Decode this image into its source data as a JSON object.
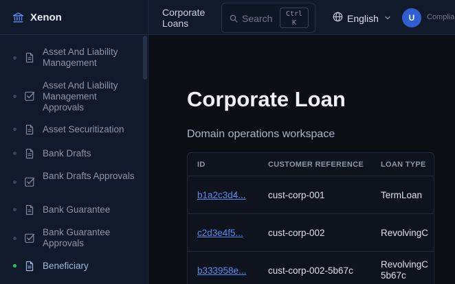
{
  "brand": {
    "name": "Xenon"
  },
  "sidebar": {
    "items": [
      {
        "label": "Asset And Liability Management",
        "icon": "document-icon"
      },
      {
        "label": "Asset And Liability Management Approvals",
        "icon": "checkbox-icon"
      },
      {
        "label": "Asset Securitization",
        "icon": "document-icon"
      },
      {
        "label": "Bank Drafts",
        "icon": "document-icon"
      },
      {
        "label": "Bank Drafts Approvals",
        "icon": "checkbox-icon"
      },
      {
        "label": "Bank Guarantee",
        "icon": "document-icon"
      },
      {
        "label": "Bank Guarantee Approvals",
        "icon": "checkbox-icon"
      },
      {
        "label": "Beneficiary",
        "icon": "document-icon",
        "active": true
      }
    ]
  },
  "header": {
    "breadcrumb": "Corporate Loans",
    "search": {
      "placeholder": "Search",
      "shortcut_top": "Ctrl",
      "shortcut_bottom": "K"
    },
    "language": "English",
    "avatar_initial": "U",
    "user_name": "Complia"
  },
  "main": {
    "title": "Corporate Loan",
    "subtitle": "Domain operations workspace",
    "table": {
      "columns": [
        "ID",
        "CUSTOMER REFERENCE",
        "LOAN TYPE"
      ],
      "rows": [
        {
          "id": "b1a2c3d4...",
          "customer_reference": "cust-corp-001",
          "loan_type": "TermLoan"
        },
        {
          "id": "c2d3e4f5...",
          "customer_reference": "cust-corp-002",
          "loan_type": "RevolvingC"
        },
        {
          "id": "b333958e...",
          "customer_reference": "cust-corp-002-5b67c",
          "loan_type": "RevolvingC 5b67c"
        }
      ]
    }
  },
  "colors": {
    "accent": "#2f5fd0",
    "link": "#5b8cf0",
    "active_dot": "#22c55e"
  }
}
